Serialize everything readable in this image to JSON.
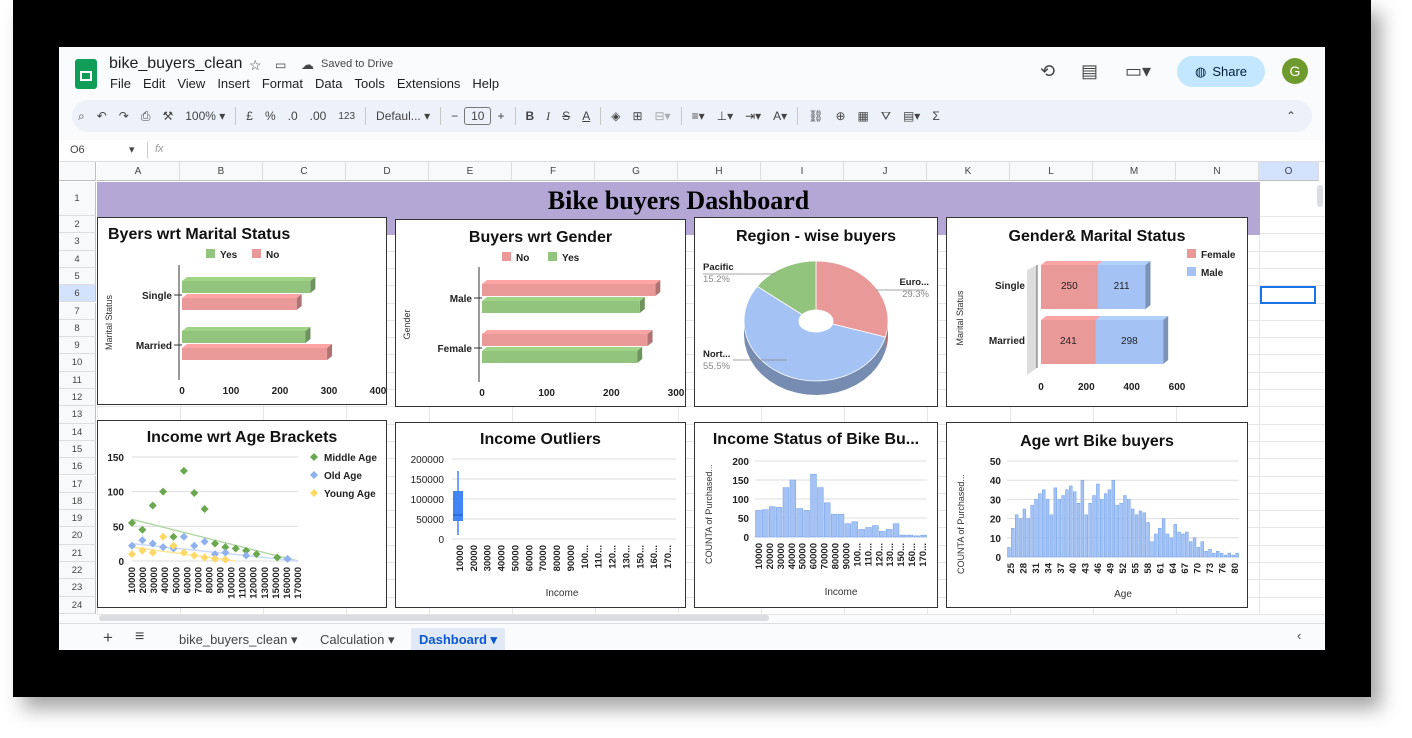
{
  "doc_title": "bike_buyers_clean",
  "saved_status": "Saved to Drive",
  "menu": [
    "File",
    "Edit",
    "View",
    "Insert",
    "Format",
    "Data",
    "Tools",
    "Extensions",
    "Help"
  ],
  "share_label": "Share",
  "avatar_letter": "G",
  "toolbar": {
    "zoom": "100%",
    "currency": "£",
    "percent": "%",
    "dec_dec": ".0",
    "inc_dec": ".00",
    "number_format": "123",
    "font": "Defaul...",
    "font_size": "10"
  },
  "cell_ref": "O6",
  "fx": "fx",
  "columns": [
    "A",
    "B",
    "C",
    "D",
    "E",
    "F",
    "G",
    "H",
    "I",
    "J",
    "K",
    "L",
    "M",
    "N",
    "O"
  ],
  "rows": [
    "1",
    "2",
    "3",
    "4",
    "5",
    "6",
    "7",
    "8",
    "9",
    "10",
    "11",
    "12",
    "13",
    "14",
    "15",
    "16",
    "17",
    "18",
    "19",
    "20",
    "21",
    "22",
    "23",
    "24"
  ],
  "banner_title": "Bike buyers Dashboard",
  "sheets": [
    "bike_buyers_clean",
    "Calculation",
    "Dashboard"
  ],
  "active_sheet": "Dashboard",
  "chart_data": [
    {
      "type": "bar",
      "title": "Byers wrt Marital Status",
      "categories": [
        "Single",
        "Married"
      ],
      "series": [
        {
          "name": "Yes",
          "color": "#93c47d",
          "values": [
            262,
            252
          ]
        },
        {
          "name": "No",
          "color": "#e06666",
          "values": [
            234,
            296
          ]
        }
      ],
      "ylabel": "Marital Status",
      "xlim": [
        0,
        400
      ],
      "xticks": [
        "0",
        "100",
        "200",
        "300",
        "400"
      ],
      "legend": "top"
    },
    {
      "type": "bar",
      "title": "Buyers wrt Gender",
      "categories": [
        "Male",
        "Female"
      ],
      "series": [
        {
          "name": "No",
          "color": "#e06666",
          "values": [
            268,
            256
          ]
        },
        {
          "name": "Yes",
          "color": "#93c47d",
          "values": [
            244,
            240
          ]
        }
      ],
      "ylabel": "Gender",
      "xlim": [
        0,
        300
      ],
      "xticks": [
        "0",
        "100",
        "200",
        "300"
      ],
      "legend": "top"
    },
    {
      "type": "pie",
      "title": "Region - wise buyers",
      "slices": [
        {
          "label": "Euro...",
          "pct": "29.3%",
          "value": 29.3,
          "color": "#ea9999"
        },
        {
          "label": "Nort...",
          "pct": "55.5%",
          "value": 55.5,
          "color": "#a4c2f4"
        },
        {
          "label": "Pacific",
          "pct": "15.2%",
          "value": 15.2,
          "color": "#93c47d"
        }
      ]
    },
    {
      "type": "bar",
      "title": "Gender& Marital Status",
      "categories": [
        "Single",
        "Married"
      ],
      "stacked": true,
      "series": [
        {
          "name": "Female",
          "color": "#ea9999",
          "values": [
            250,
            241
          ]
        },
        {
          "name": "Male",
          "color": "#a4c2f4",
          "values": [
            211,
            298
          ]
        }
      ],
      "ylabel": "Marital Status",
      "xlim": [
        0,
        600
      ],
      "xticks": [
        "0",
        "200",
        "400",
        "600"
      ],
      "legend": "right"
    },
    {
      "type": "scatter",
      "title": "Income wrt Age Brackets",
      "ylim": [
        0,
        150
      ],
      "yticks": [
        "0",
        "50",
        "100",
        "150"
      ],
      "xticks": [
        "10000",
        "20000",
        "30000",
        "40000",
        "50000",
        "60000",
        "70000",
        "80000",
        "90000",
        "100000",
        "110000",
        "120000",
        "130000",
        "150000",
        "160000",
        "170000"
      ],
      "series": [
        {
          "name": "Middle Age",
          "color": "#6aa84f",
          "points": [
            [
              10000,
              55
            ],
            [
              20000,
              45
            ],
            [
              30000,
              80
            ],
            [
              40000,
              100
            ],
            [
              50000,
              35
            ],
            [
              60000,
              130
            ],
            [
              70000,
              98
            ],
            [
              80000,
              75
            ],
            [
              90000,
              25
            ],
            [
              100000,
              20
            ],
            [
              110000,
              18
            ],
            [
              120000,
              15
            ],
            [
              130000,
              10
            ],
            [
              150000,
              5
            ]
          ]
        },
        {
          "name": "Old Age",
          "color": "#8fb1ee",
          "points": [
            [
              10000,
              22
            ],
            [
              20000,
              30
            ],
            [
              30000,
              25
            ],
            [
              40000,
              20
            ],
            [
              50000,
              18
            ],
            [
              60000,
              35
            ],
            [
              70000,
              22
            ],
            [
              80000,
              28
            ],
            [
              90000,
              10
            ],
            [
              100000,
              12
            ],
            [
              120000,
              8
            ],
            [
              160000,
              3
            ]
          ]
        },
        {
          "name": "Young Age",
          "color": "#ffd966",
          "points": [
            [
              10000,
              10
            ],
            [
              20000,
              15
            ],
            [
              30000,
              12
            ],
            [
              40000,
              35
            ],
            [
              50000,
              22
            ],
            [
              60000,
              12
            ],
            [
              70000,
              8
            ],
            [
              80000,
              5
            ],
            [
              90000,
              3
            ],
            [
              100000,
              2
            ]
          ]
        }
      ],
      "legend": "right"
    },
    {
      "type": "box",
      "title": "Income Outliers",
      "xlabel": "Income",
      "ylim": [
        0,
        200000
      ],
      "yticks": [
        "0",
        "50000",
        "100000",
        "150000",
        "200000"
      ],
      "xticks": [
        "10000",
        "20000",
        "30000",
        "40000",
        "50000",
        "60000",
        "70000",
        "80000",
        "90000",
        "100...",
        "110...",
        "120...",
        "130...",
        "150...",
        "160...",
        "170..."
      ],
      "box": {
        "min": 10000,
        "q1": 45000,
        "median": 60000,
        "q3": 120000,
        "max": 170000
      }
    },
    {
      "type": "bar",
      "title": "Income Status of Bike Bu...",
      "xlabel": "Income",
      "ylabel": "COUNTA of Purchased...",
      "ylim": [
        0,
        200
      ],
      "yticks": [
        "0",
        "50",
        "100",
        "150",
        "200"
      ],
      "xticks": [
        "10000",
        "20000",
        "30000",
        "40000",
        "50000",
        "60000",
        "70000",
        "80000",
        "90000",
        "100...",
        "110...",
        "120...",
        "130...",
        "150...",
        "160...",
        "170..."
      ],
      "values": [
        70,
        72,
        80,
        78,
        130,
        150,
        75,
        70,
        165,
        130,
        90,
        60,
        60,
        35,
        40,
        20,
        25,
        30,
        15,
        20,
        35,
        5,
        5,
        3,
        5
      ]
    },
    {
      "type": "bar",
      "title": "Age wrt Bike buyers",
      "xlabel": "Age",
      "ylabel": "COUNTA of Purchased...",
      "ylim": [
        0,
        50
      ],
      "yticks": [
        "0",
        "10",
        "20",
        "30",
        "40",
        "50"
      ],
      "xticks": [
        "25",
        "28",
        "31",
        "34",
        "37",
        "40",
        "43",
        "46",
        "49",
        "52",
        "55",
        "58",
        "61",
        "64",
        "67",
        "70",
        "73",
        "76",
        "80"
      ],
      "values": [
        5,
        15,
        22,
        20,
        25,
        20,
        27,
        30,
        33,
        35,
        30,
        22,
        36,
        30,
        32,
        35,
        37,
        34,
        28,
        40,
        22,
        28,
        32,
        38,
        30,
        33,
        35,
        40,
        27,
        28,
        32,
        30,
        25,
        22,
        24,
        23,
        18,
        8,
        12,
        15,
        20,
        12,
        10,
        17,
        13,
        12,
        13,
        8,
        10,
        5,
        8,
        3,
        4,
        2,
        3,
        2,
        1,
        2,
        1,
        2
      ]
    }
  ]
}
